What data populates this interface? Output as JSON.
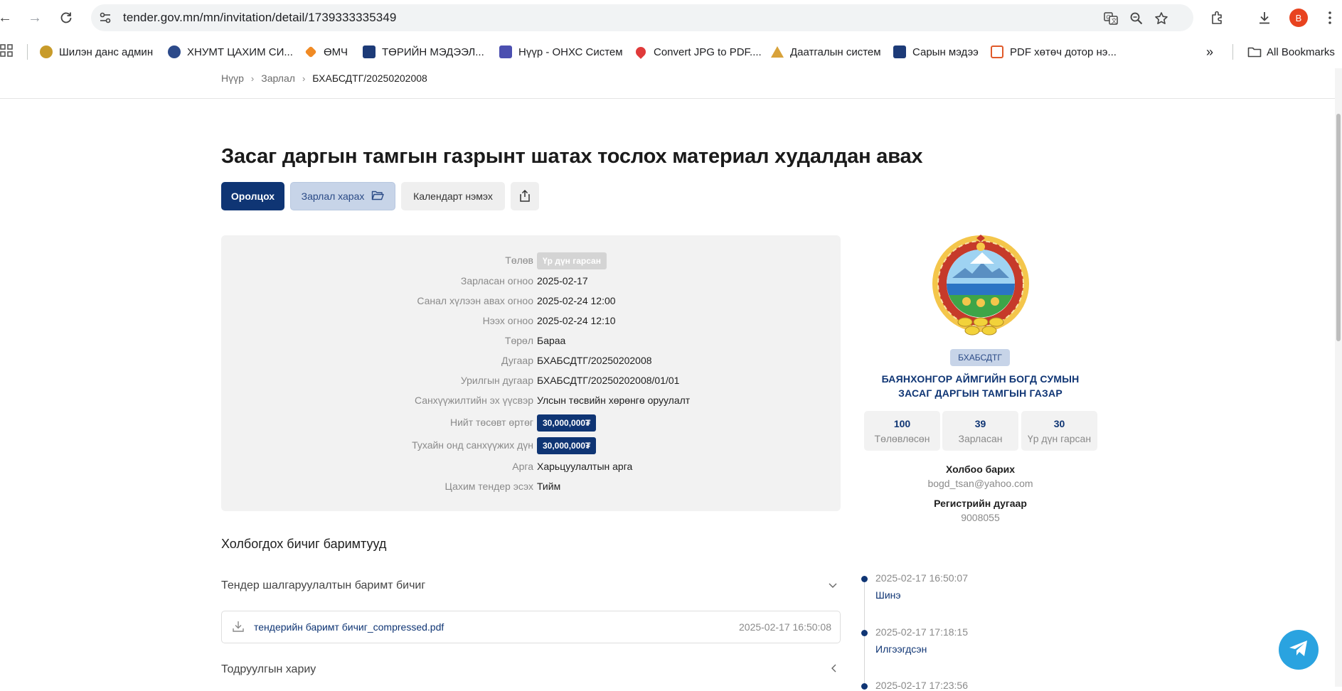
{
  "browser": {
    "url": "tender.gov.mn/mn/invitation/detail/1739333335349",
    "avatar_letter": "B",
    "bookmarks": [
      {
        "label": "Шилэн данс админ",
        "color": "#c89b2a"
      },
      {
        "label": "ХНУМТ ЦАХИМ СИ...",
        "color": "#2c4a8a"
      },
      {
        "label": "ӨМЧ",
        "color": "#f08a24"
      },
      {
        "label": "ТӨРИЙН МЭДЭЭЛ...",
        "color": "#1d3b78"
      },
      {
        "label": "Нүүр - ОНХС Систем",
        "color": "#4b4fb0"
      },
      {
        "label": "Convert JPG to PDF....",
        "color": "#e03a3a"
      },
      {
        "label": "Даатгалын систем",
        "color": "#d8a23a"
      },
      {
        "label": "Сарын мэдээ",
        "color": "#1d3b78"
      },
      {
        "label": "PDF хөтөч дотор нэ...",
        "color": "#e05a2a"
      }
    ],
    "more_bookmarks": "»",
    "all_bookmarks": "All Bookmarks"
  },
  "breadcrumb": {
    "home": "Нүүр",
    "section": "Зарлал",
    "current": "БХАБСДТГ/20250202008"
  },
  "page": {
    "title": "Засаг даргын тамгын газрынт шатах тослох материал худалдан авах",
    "buttons": {
      "participate": "Оролцох",
      "view_docs": "Зарлал харах",
      "add_calendar": "Календарт нэмэх"
    }
  },
  "details": [
    {
      "label": "Төлөв",
      "value": "Үр дүн гарсан",
      "style": "pill-gray"
    },
    {
      "label": "Зарласан огноо",
      "value": "2025-02-17",
      "style": "text"
    },
    {
      "label": "Санал хүлээн авах огноо",
      "value": "2025-02-24 12:00",
      "style": "text"
    },
    {
      "label": "Нээх огноо",
      "value": "2025-02-24 12:10",
      "style": "text"
    },
    {
      "label": "Төрөл",
      "value": "Бараа",
      "style": "text"
    },
    {
      "label": "Дугаар",
      "value": "БХАБСДТГ/20250202008",
      "style": "text"
    },
    {
      "label": "Урилгын дугаар",
      "value": "БХАБСДТГ/20250202008/01/01",
      "style": "text"
    },
    {
      "label": "Санхүүжилтийн эх үүсвэр",
      "value": "Улсын төсвийн хөрөнгө оруулалт",
      "style": "text"
    },
    {
      "label": "Нийт төсөвт өртөг",
      "value": "30,000,000₮",
      "style": "pill-navy"
    },
    {
      "label": "Тухайн онд санхүүжих дүн",
      "value": "30,000,000₮",
      "style": "pill-navy"
    },
    {
      "label": "Арга",
      "value": "Харьцуулалтын арга",
      "style": "text"
    },
    {
      "label": "Цахим тендер эсэх",
      "value": "Тийм",
      "style": "text"
    }
  ],
  "org": {
    "badge": "БХАБСДТГ",
    "name": "БАЯНХОНГОР АЙМГИЙН БОГД СУМЫН ЗАСАГ ДАРГЫН ТАМГЫН ГАЗАР",
    "stats": [
      {
        "number": "100",
        "label": "Төлөвлөсөн"
      },
      {
        "number": "39",
        "label": "Зарласан"
      },
      {
        "number": "30",
        "label": "Үр дүн гарсан"
      }
    ],
    "contact_label": "Холбоо барих",
    "contact_email": "bogd_tsan@yahoo.com",
    "reg_label": "Регистрийн дугаар",
    "reg_number": "9008055"
  },
  "documents": {
    "heading": "Холбогдох бичиг баримтууд",
    "sections": [
      {
        "title": "Тендер шалгаруулалтын баримт бичиг",
        "expanded": true
      },
      {
        "title": "Тодруулгын хариу",
        "expanded": false
      }
    ],
    "file": {
      "name": "тендерийн баримт бичиг_compressed.pdf",
      "date": "2025-02-17 16:50:08"
    }
  },
  "timeline": [
    {
      "time": "2025-02-17 16:50:07",
      "status": "Шинэ"
    },
    {
      "time": "2025-02-17 17:18:15",
      "status": "Илгээгдсэн"
    },
    {
      "time": "2025-02-17 17:23:56",
      "status": ""
    }
  ]
}
